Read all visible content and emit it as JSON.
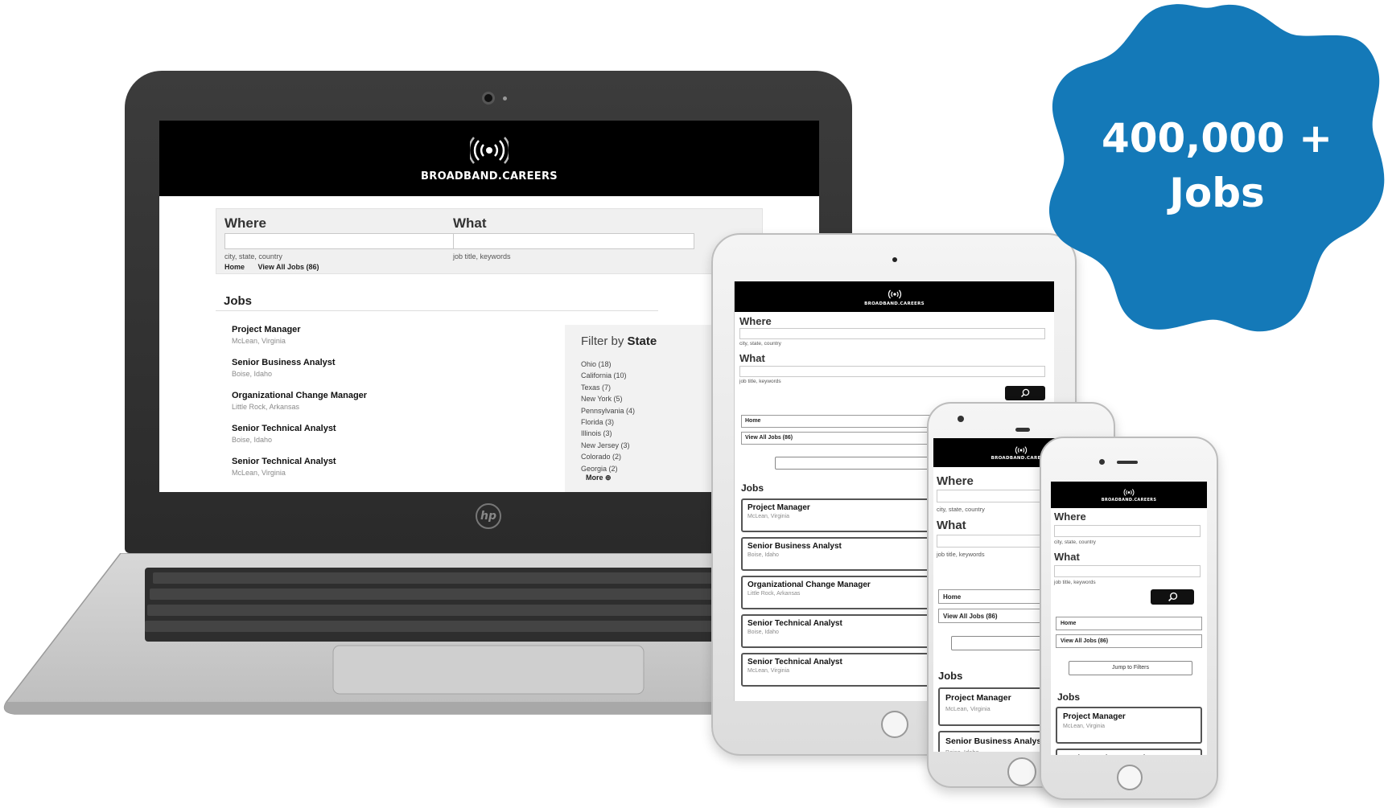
{
  "brand": "BROADBAND.CAREERS",
  "badge": {
    "line1": "400,000 +",
    "line2": "Jobs",
    "color": "#1479b8"
  },
  "search": {
    "where_label": "Where",
    "what_label": "What",
    "where_hint": "city, state, country",
    "what_hint": "job title, keywords"
  },
  "nav": {
    "home": "Home",
    "view_all": "View All Jobs (86)",
    "jump": "Jump to Filters"
  },
  "jobs_title": "Jobs",
  "jobs": [
    {
      "title": "Project Manager",
      "location": "McLean, Virginia"
    },
    {
      "title": "Senior Business Analyst",
      "location": "Boise, Idaho"
    },
    {
      "title": "Organizational Change Manager",
      "location": "Little Rock, Arkansas"
    },
    {
      "title": "Senior Technical Analyst",
      "location": "Boise, Idaho"
    },
    {
      "title": "Senior Technical Analyst",
      "location": "McLean, Virginia"
    }
  ],
  "filter": {
    "title_prefix": "Filter by",
    "title_bold": "State",
    "states": [
      "Ohio (18)",
      "California (10)",
      "Texas (7)",
      "New York (5)",
      "Pennsylvania (4)",
      "Florida (3)",
      "Illinois (3)",
      "New Jersey (3)",
      "Colorado (2)",
      "Georgia (2)"
    ],
    "more": "More"
  },
  "icons": {
    "brand_icon": "broadcast-signal-icon",
    "search_icon": "magnifier-icon",
    "more_icon": "plus-circle-icon",
    "laptop_logo": "hp-logo-icon"
  }
}
